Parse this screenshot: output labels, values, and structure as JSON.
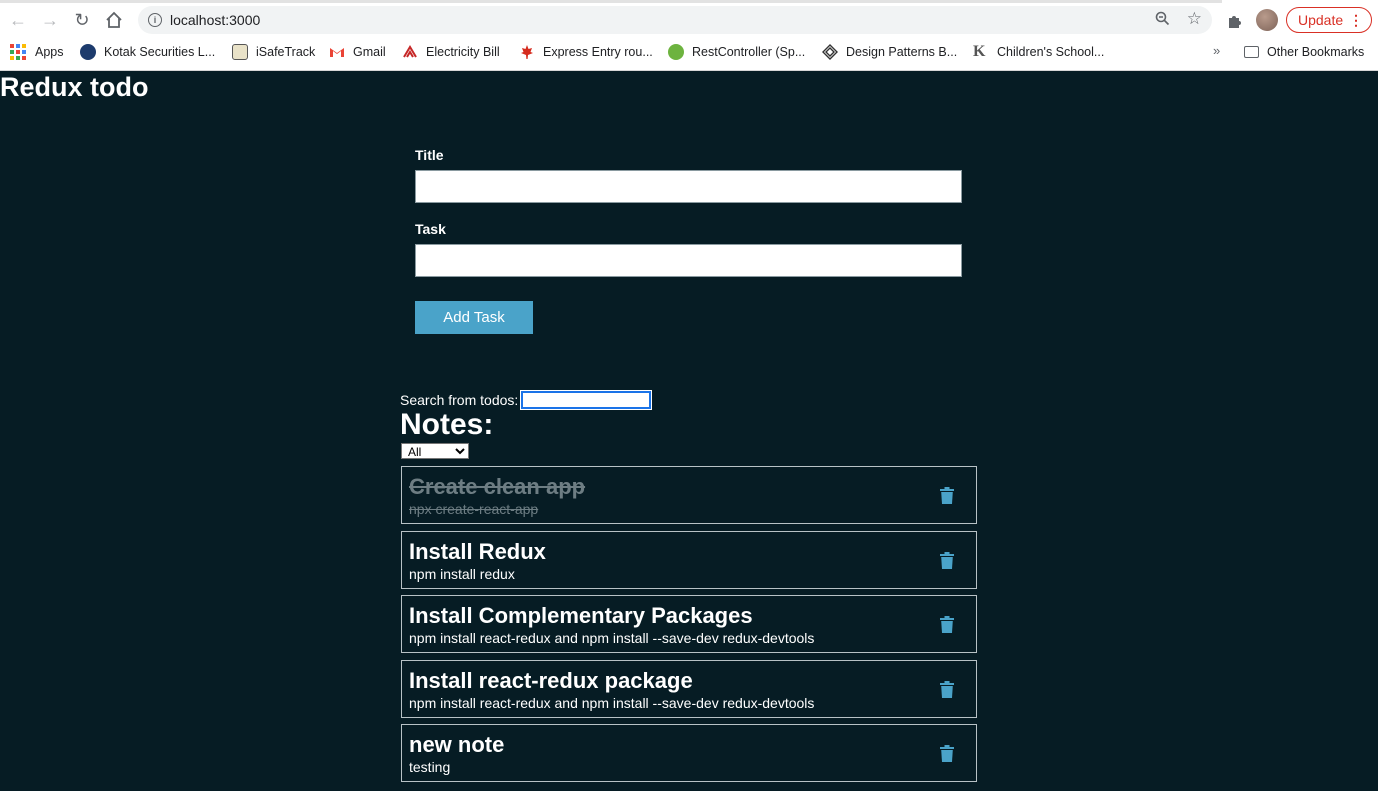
{
  "browser": {
    "url": "localhost:3000",
    "update_label": "Update",
    "bookmarks": [
      {
        "label": "Apps"
      },
      {
        "label": "Kotak Securities L..."
      },
      {
        "label": "iSafeTrack"
      },
      {
        "label": "Gmail"
      },
      {
        "label": "Electricity Bill"
      },
      {
        "label": "Express Entry rou..."
      },
      {
        "label": "RestController (Sp..."
      },
      {
        "label": "Design Patterns B..."
      },
      {
        "label": "Children's School..."
      }
    ],
    "more_label": "»",
    "other_bookmarks": "Other Bookmarks"
  },
  "app": {
    "title": "Redux todo",
    "form": {
      "title_label": "Title",
      "title_value": "",
      "task_label": "Task",
      "task_value": "",
      "add_button": "Add Task"
    },
    "search": {
      "label": "Search from todos:",
      "value": ""
    },
    "notes_heading": "Notes:",
    "filter": {
      "selected": "All"
    },
    "notes": [
      {
        "title": "Create clean app",
        "task": "npx create-react-app",
        "completed": true
      },
      {
        "title": "Install Redux",
        "task": "npm install redux",
        "completed": false
      },
      {
        "title": "Install Complementary Packages",
        "task": "npm install react-redux and npm install --save-dev redux-devtools",
        "completed": false
      },
      {
        "title": "Install react-redux package",
        "task": "npm install react-redux and npm install --save-dev redux-devtools",
        "completed": false
      },
      {
        "title": "new note",
        "task": "testing",
        "completed": false
      }
    ]
  },
  "colors": {
    "background": "#061c24",
    "accent": "#4aa3c9",
    "update_red": "#d93025"
  }
}
